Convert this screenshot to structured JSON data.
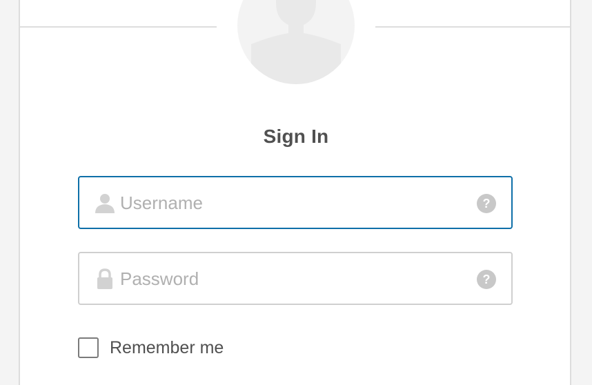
{
  "form": {
    "title": "Sign In",
    "username": {
      "placeholder": "Username",
      "value": "",
      "icon": "user-icon",
      "help_glyph": "?"
    },
    "password": {
      "placeholder": "Password",
      "value": "",
      "icon": "lock-icon",
      "help_glyph": "?"
    },
    "remember": {
      "label": "Remember me",
      "checked": false
    }
  },
  "colors": {
    "focus_border": "#0e6fa8",
    "field_border": "#cfcfcf",
    "placeholder": "#b0b0b0",
    "title_text": "#505050",
    "help_icon_bg": "#c8c8c8",
    "avatar_bg": "#f3f3f3"
  }
}
